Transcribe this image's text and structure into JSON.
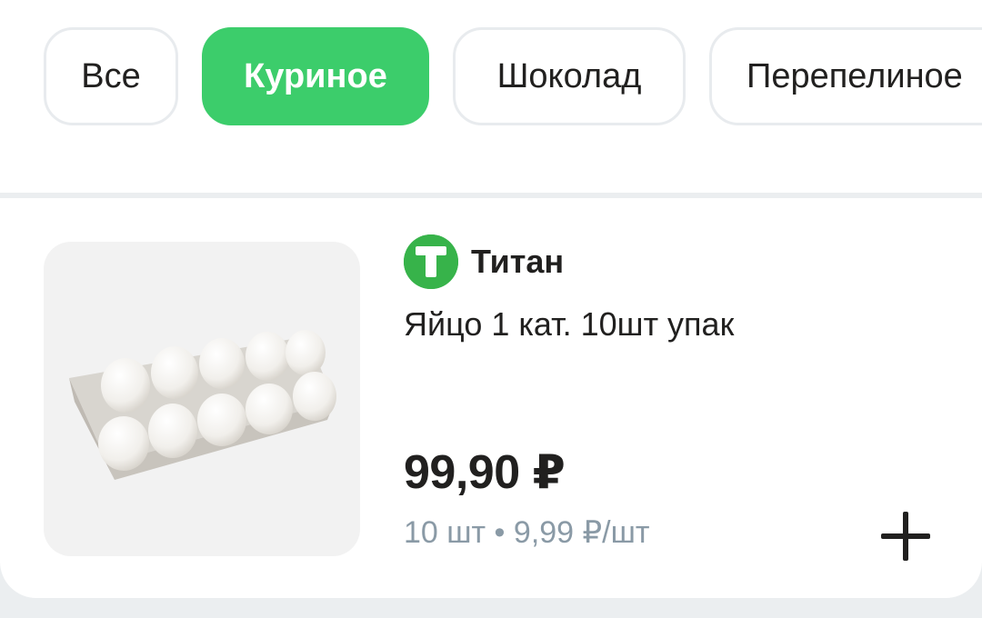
{
  "filters": {
    "chips": [
      {
        "label": "Все",
        "active": false
      },
      {
        "label": "Куриное",
        "active": true
      },
      {
        "label": "Шоколад",
        "active": false
      },
      {
        "label": "Перепелиное",
        "active": false
      }
    ]
  },
  "product": {
    "brand_logo_letter": "Т",
    "brand": "Титан",
    "title": "Яйцо 1 кат. 10шт упак",
    "price": "99,90 ₽",
    "unit_info": "10 шт • 9,99 ₽/шт",
    "image_icon": "egg-carton",
    "add_icon": "plus-icon"
  },
  "colors": {
    "accent_green": "#3ccd6b",
    "brand_green": "#37b34a",
    "muted_text": "#8a9aa6"
  }
}
